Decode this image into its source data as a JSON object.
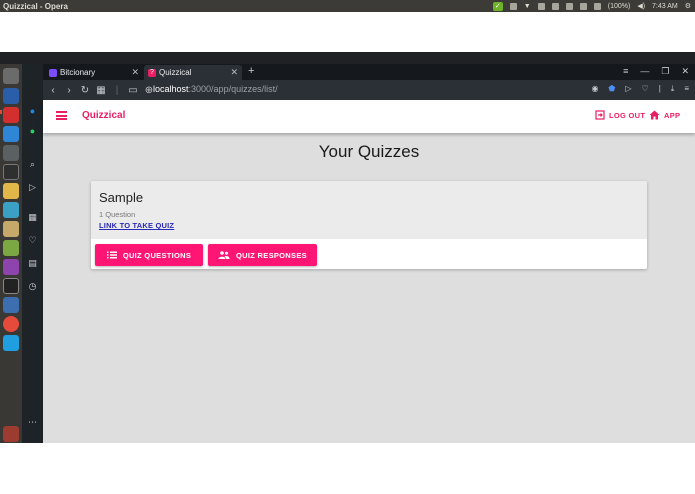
{
  "os": {
    "window_title": "Quizzical - Opera",
    "battery": "(100%)",
    "time": "7:43 AM"
  },
  "browser": {
    "tabs": [
      {
        "label": "Bitcionary",
        "active": false
      },
      {
        "label": "Quizzical",
        "active": true
      }
    ],
    "url_host": "localhost",
    "url_path": ":3000/app/quizzes/list/"
  },
  "app": {
    "brand": "Quizzical",
    "logout_label": "LOG OUT",
    "app_label": "APP",
    "accent_color": "#e91e63",
    "page_title": "Your Quizzes",
    "quizzes": [
      {
        "title": "Sample",
        "question_count": "1 Question",
        "link_label": "LINK TO TAKE QUIZ",
        "questions_button": "QUIZ QUESTIONS",
        "responses_button": "QUIZ RESPONSES"
      }
    ]
  }
}
